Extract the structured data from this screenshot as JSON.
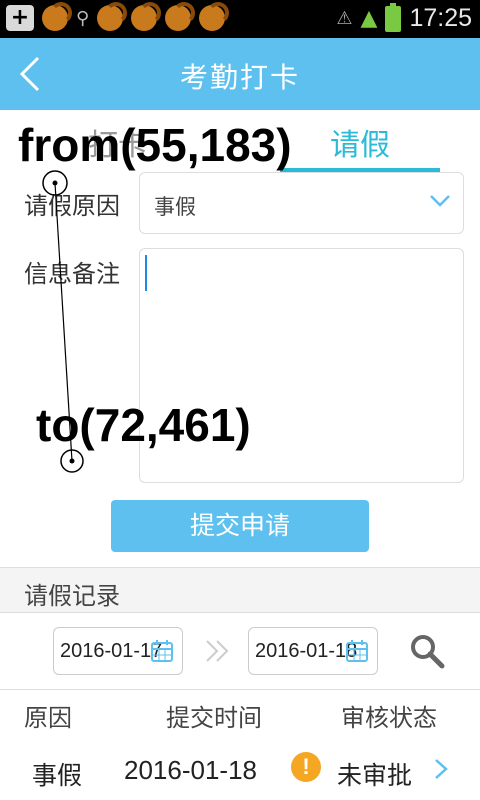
{
  "status_bar": {
    "time": "17:25",
    "icons": [
      "plus-box-icon",
      "uc-browser-icon",
      "search-icon",
      "uc-browser-icon",
      "uc-browser-icon",
      "uc-browser-icon",
      "uc-browser-icon",
      "signal-off-icon",
      "wifi-icon",
      "battery-icon"
    ]
  },
  "header": {
    "title": "考勤打卡"
  },
  "tabs": [
    {
      "label": "打卡",
      "active": false
    },
    {
      "label": "请假",
      "active": true
    }
  ],
  "overlay": {
    "from_text": "from(55,183)",
    "to_text": "to(72,461)"
  },
  "form": {
    "reason_label": "请假原因",
    "reason_value": "事假",
    "note_label": "信息备注",
    "note_value": ""
  },
  "submit_button": "提交申请",
  "records": {
    "title": "请假记录",
    "start_date": "2016-01-17",
    "end_date": "2016-01-18",
    "columns": [
      "原因",
      "提交时间",
      "审核状态"
    ],
    "rows": [
      {
        "reason": "事假",
        "date": "2016-01-18",
        "status": "未审批"
      }
    ]
  },
  "colors": {
    "header": "#5ec0ee",
    "tab_active": "#2bbbd8",
    "warning": "#f5a623"
  }
}
